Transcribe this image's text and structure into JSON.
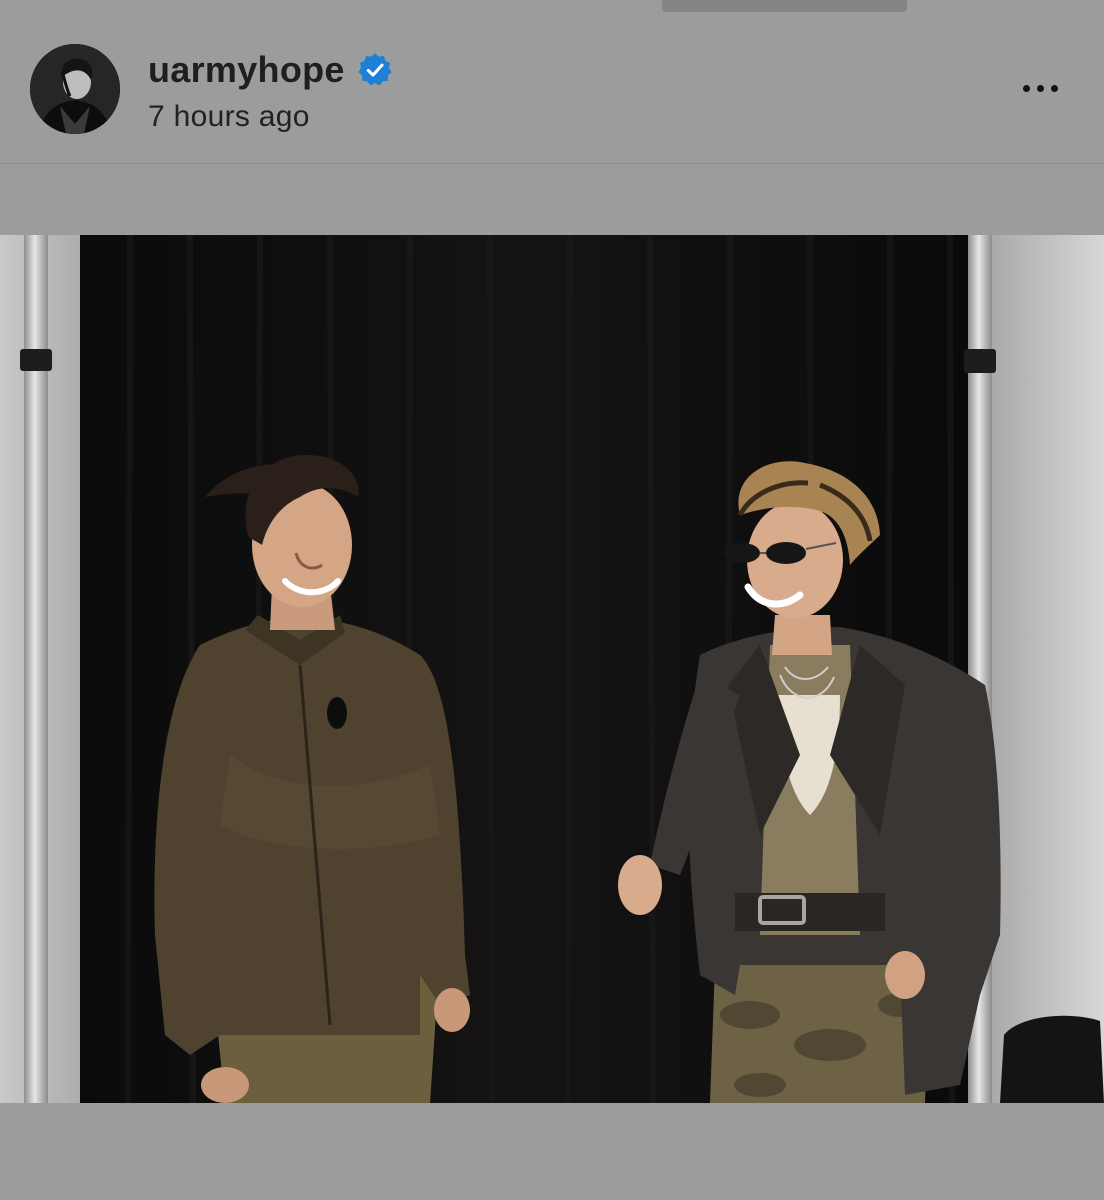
{
  "post": {
    "username": "uarmyhope",
    "timestamp": "7 hours ago",
    "verified": true
  },
  "icons": {
    "verified": "verified-badge-icon",
    "more": "more-options-icon"
  },
  "colors": {
    "background": "#9b9c9c",
    "verified_badge": "#1e7fd6",
    "text": "#1f1f1f"
  }
}
